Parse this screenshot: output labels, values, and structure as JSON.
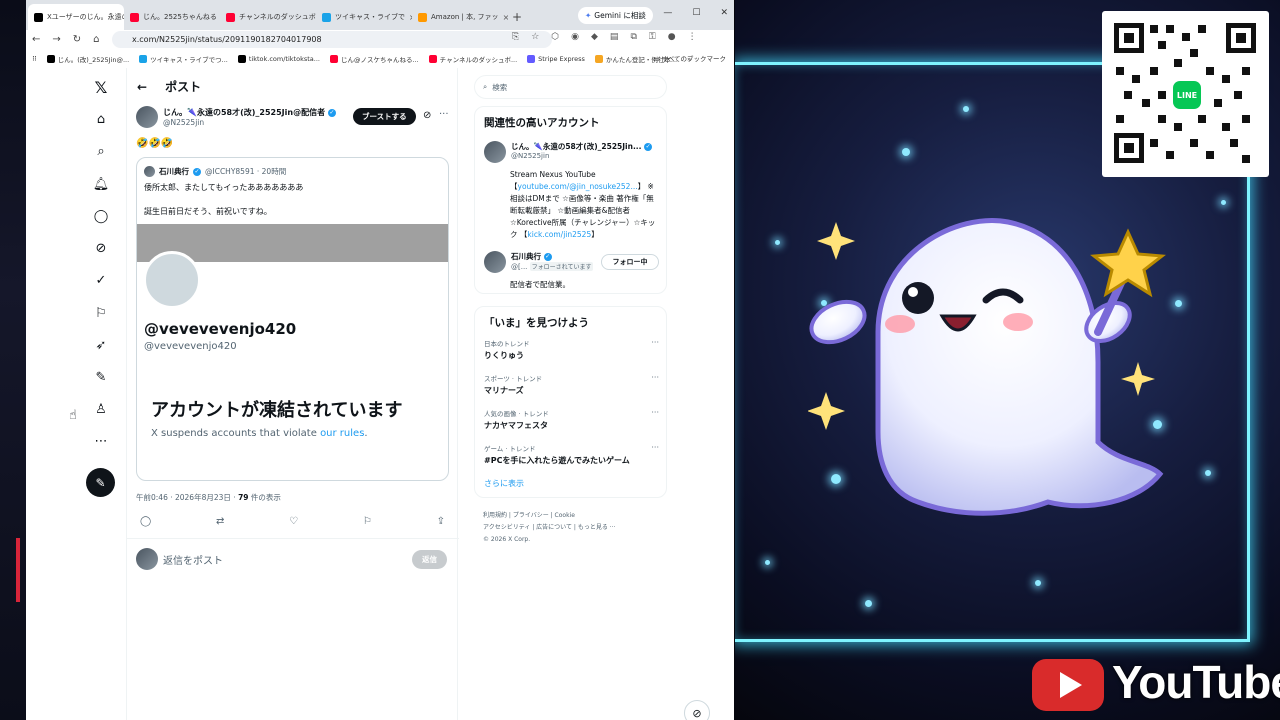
{
  "browser": {
    "tabs": [
      {
        "title": "Xユーザーのじん。永遠の",
        "fav": "#000000",
        "active": true
      },
      {
        "title": "じん。2525ちゃんねる",
        "fav": "#ff0033",
        "active": false
      },
      {
        "title": "チャンネルのダッシュボ",
        "fav": "#ff0033",
        "active": false
      },
      {
        "title": "ツイキャス・ライブで",
        "fav": "#1aa3e8",
        "active": false
      },
      {
        "title": "Amazon | 本, ファッ",
        "fav": "#ff9900",
        "active": false
      }
    ],
    "new_tab": "+",
    "gemini_label": "Gemini に相談",
    "url": "x.com/N2525jin/status/2091190182704017908",
    "bookmarks": [
      {
        "label": "じん。(改)_2525Jin@...",
        "fav": "#000000"
      },
      {
        "label": "ツイキャス・ライブでつ...",
        "fav": "#1aa3e8"
      },
      {
        "label": "tiktok.com/tiktoksta...",
        "fav": "#000000"
      },
      {
        "label": "じん@ノスケちゃんねる...",
        "fav": "#ff0033"
      },
      {
        "label": "チャンネルのダッシュボ...",
        "fav": "#ff0033"
      },
      {
        "label": "Stripe Express",
        "fav": "#635bff"
      },
      {
        "label": "かんたん登記・例社本...",
        "fav": "#f5a623"
      }
    ],
    "bookmarks_more": "»",
    "all_bookmarks": "すべてのブックマーク"
  },
  "header": {
    "back": "←",
    "title": "ポスト"
  },
  "post": {
    "author_name": "じん。🌂永遠の58才(改)_2525Jin@配信者",
    "author_handle": "@N2525jin",
    "boost_label": "ブーストする",
    "text": "🤣🤣🤣",
    "quote": {
      "name": "石川典行",
      "handle": "@ICCHY8591 · 20時間",
      "text": "倭所太郎、またしてもイったあああああああ\n\n誕生日前日だそう、前祝いですね。",
      "profile_name": "@vevevevenjo420",
      "profile_handle": "@vevevevenjo420",
      "suspended_title": "アカウントが凍結されています",
      "suspended_body": "X suspends accounts that violate ",
      "suspended_link": "our rules",
      "suspended_end": "."
    },
    "time": "午前0:46 · 2026年8月23日 · ",
    "views_count": "79",
    "views_label": " 件の表示",
    "reply_placeholder": "返信をポスト",
    "reply_button": "返信"
  },
  "sidebar": {
    "search_placeholder": "検索",
    "related_title": "関連性の高いアカウント",
    "acc1": {
      "name": "じん。🌂永遠の58才(改)_2525Jin...",
      "handle": "@N2525jin",
      "bio_1": "Stream Nexus YouTube 【",
      "bio_link1": "youtube.com/@jin_nosuke252...",
      "bio_2": "】 ※相談はDMまで ☆画像等・楽曲 著作権「無断転載厳禁」 ☆動画編集者&配信者 ☆Korective所属（チャレンジャー）☆キック 【",
      "bio_link2": "kick.com/jin2525",
      "bio_3": "】"
    },
    "acc2": {
      "name": "石川典行",
      "handle": "@[...",
      "follows_you": "フォローされています",
      "follow_button": "フォロー中",
      "bio": "配信者で配信業。"
    },
    "trends_title": "「いま」を見つけよう",
    "trends": [
      {
        "category": "日本のトレンド",
        "title": "りくりゅう"
      },
      {
        "category": "スポーツ · トレンド",
        "title": "マリナーズ"
      },
      {
        "category": "人気の画像 · トレンド",
        "title": "ナカヤマフェスタ"
      },
      {
        "category": "ゲーム · トレンド",
        "title": "#PCを手に入れたら遊んでみたいゲーム"
      }
    ],
    "show_more": "さらに表示",
    "footer_1": "利用規約 | プライバシー | Cookie",
    "footer_2": "アクセシビリティ | 広告について | もっと見る ···",
    "footer_3": "© 2026 X Corp."
  },
  "stream": {
    "qr_badge": "LINE",
    "youtube_text": "YouTube"
  },
  "colors": {
    "accent": "#1d9bf0",
    "neon": "#7ff4ff",
    "youtube": "#d92b2b"
  }
}
